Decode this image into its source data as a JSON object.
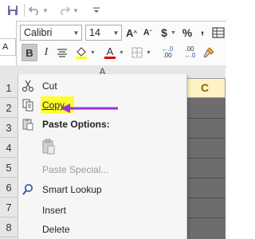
{
  "quick_access": {
    "save_icon": "save-icon",
    "undo_icon": "undo-icon",
    "redo_icon": "redo-icon",
    "customize_icon": "chevron-down-icon"
  },
  "mini_toolbar": {
    "font_name": "Calibri",
    "font_size": "14",
    "grow_font": "A",
    "shrink_font": "A",
    "accounting": "$",
    "percent": "%",
    "comma": ",",
    "bold": "B",
    "italic": "I",
    "fill_color": "#ffff00",
    "font_color": "#e00000",
    "increase_decimal_top": "←.0",
    "increase_decimal_bottom": ".00",
    "decrease_decimal_top": ".00",
    "decrease_decimal_bottom": "→.0"
  },
  "name_box": {
    "value": "A"
  },
  "column_header": {
    "a": "A"
  },
  "cell_c1": {
    "text": "C"
  },
  "row_numbers": [
    "1",
    "2",
    "3",
    "4",
    "5",
    "6",
    "7",
    "8"
  ],
  "context_menu": {
    "items": [
      {
        "label": "Cut",
        "icon": "scissors-icon"
      },
      {
        "label": "Copy",
        "icon": "copy-icon",
        "highlight": "#fdff2e"
      },
      {
        "label": "Paste Options:",
        "icon": "paste-icon"
      },
      {
        "label": "",
        "icon": "paste-clipboard-icon"
      },
      {
        "label": "Paste Special...",
        "icon": ""
      },
      {
        "label": "Smart Lookup",
        "icon": "search-icon"
      },
      {
        "label": "Insert",
        "icon": ""
      },
      {
        "label": "Delete",
        "icon": ""
      }
    ]
  },
  "annotation": {
    "arrow_color": "#9b30d9"
  }
}
